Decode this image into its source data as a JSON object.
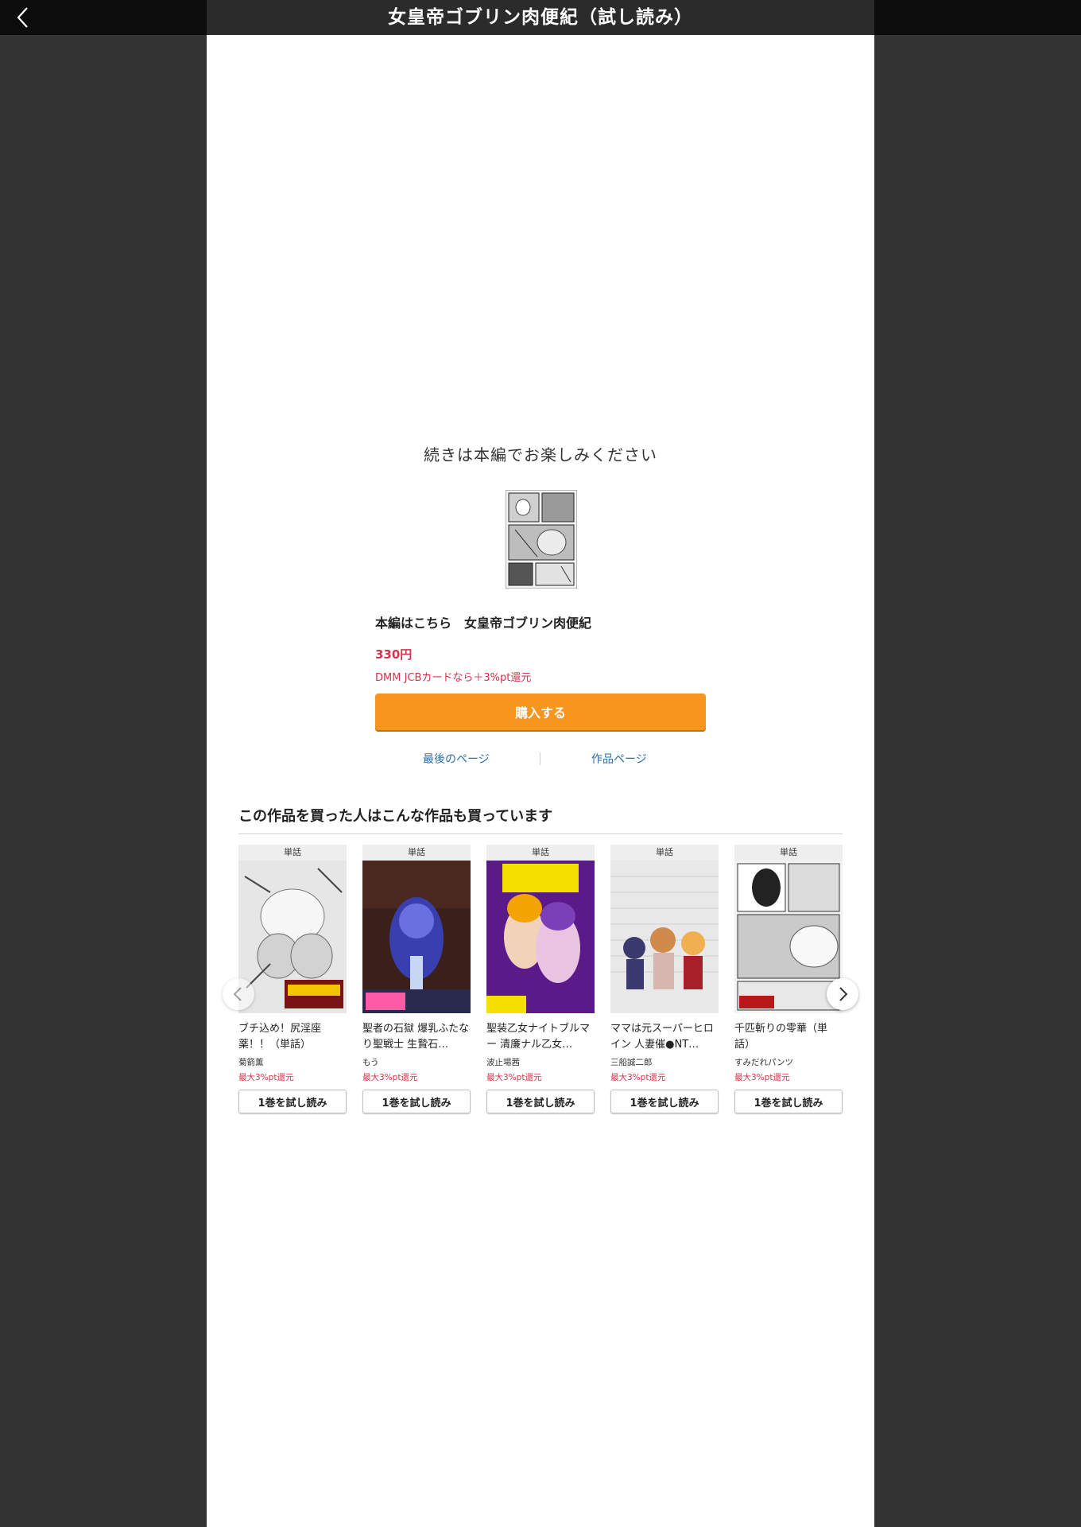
{
  "header": {
    "title": "女皇帝ゴブリン肉便紀（試し読み）",
    "back_icon": "chevron-left-icon"
  },
  "end_of_preview": {
    "continue_text": "続きは本編でお楽しみください",
    "main_label": "本編はこちら　女皇帝ゴブリン肉便紀",
    "price": "330円",
    "cashback": "DMM JCBカードなら＋3%pt還元",
    "buy_label": "購入する",
    "last_page_link": "最後のページ",
    "work_page_link": "作品ページ"
  },
  "recommendations": {
    "title": "この作品を買った人はこんな作品も買っています",
    "items": [
      {
        "badge": "単話",
        "title": "ブチ込め！尻淫座薬！！（単話）",
        "author": "菊箭薫",
        "point": "最大3%pt還元",
        "button": "1巻を試し読み"
      },
      {
        "badge": "単話",
        "title": "聖者の石獄 爆乳ふたなり聖戦士 生贄石…",
        "author": "もう",
        "point": "最大3%pt還元",
        "button": "1巻を試し読み"
      },
      {
        "badge": "単話",
        "title": "聖装乙女ナイトブルマー 清廉ナル乙女…",
        "author": "波止場茜",
        "point": "最大3%pt還元",
        "button": "1巻を試し読み"
      },
      {
        "badge": "単話",
        "title": "ママは元スーパーヒロイン 人妻催●NT…",
        "author": "三船誠二郎",
        "point": "最大3%pt還元",
        "button": "1巻を試し読み"
      },
      {
        "badge": "単話",
        "title": "千匹斬りの零華（単話）",
        "author": "すみだれパンツ",
        "point": "最大3%pt還元",
        "button": "1巻を試し読み"
      }
    ]
  },
  "colors": {
    "accent": "#f7961d",
    "price": "#d6334a",
    "link": "#2f6fa3"
  }
}
